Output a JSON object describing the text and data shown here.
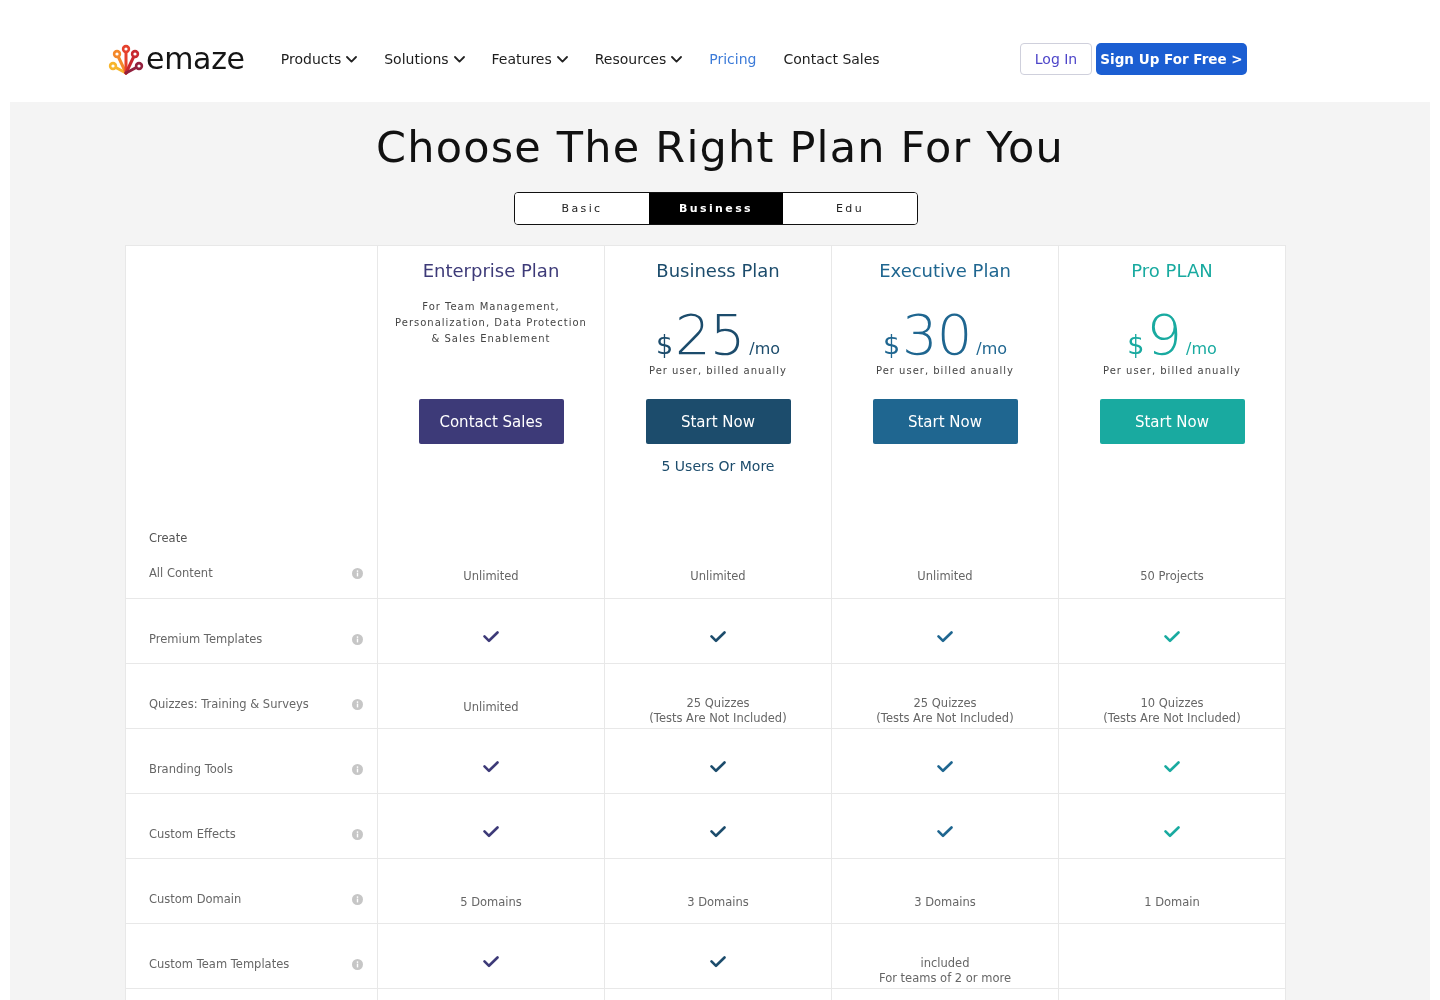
{
  "header": {
    "brand": "emaze",
    "nav": [
      {
        "label": "Products",
        "dropdown": true,
        "selected": false
      },
      {
        "label": "Solutions",
        "dropdown": true,
        "selected": false
      },
      {
        "label": "Features",
        "dropdown": true,
        "selected": false
      },
      {
        "label": "Resources",
        "dropdown": true,
        "selected": false
      },
      {
        "label": "Pricing",
        "dropdown": false,
        "selected": true
      },
      {
        "label": "Contact Sales",
        "dropdown": false,
        "selected": false
      }
    ],
    "login": "Log In",
    "signup": "Sign Up For Free >"
  },
  "title": "Choose The Right Plan For You",
  "tabs": [
    {
      "label": "Basic",
      "selected": false
    },
    {
      "label": "Business",
      "selected": true
    },
    {
      "label": "Edu",
      "selected": false
    }
  ],
  "plans": [
    {
      "name": "Enterprise Plan",
      "color": "#3d3a78",
      "description": "For Team Management,\nPersonalization, Data Protection\n& Sales Enablement",
      "button": "Contact Sales"
    },
    {
      "name": "Business Plan",
      "color": "#1c4c6c",
      "price": {
        "currency": "$",
        "amount": "25",
        "period": "/mo"
      },
      "billing": "Per user, billed anually",
      "button": "Start Now",
      "note": "5 Users Or More"
    },
    {
      "name": "Executive Plan",
      "color": "#1f6690",
      "price": {
        "currency": "$",
        "amount": "30",
        "period": "/mo"
      },
      "billing": "Per user, billed anually",
      "button": "Start Now"
    },
    {
      "name": "Pro PLAN",
      "color": "#19aaa0",
      "price": {
        "currency": "$",
        "amount": "9",
        "period": "/mo"
      },
      "billing": "Per user, billed anually",
      "button": "Start Now"
    }
  ],
  "features": {
    "group": "Create",
    "rows": [
      {
        "label": "All Content",
        "values": [
          {
            "kind": "text",
            "text": "Unlimited"
          },
          {
            "kind": "text",
            "text": "Unlimited"
          },
          {
            "kind": "text",
            "text": "Unlimited"
          },
          {
            "kind": "text",
            "text": "50 Projects"
          }
        ]
      },
      {
        "label": "Premium Templates",
        "values": [
          {
            "kind": "check"
          },
          {
            "kind": "check"
          },
          {
            "kind": "check"
          },
          {
            "kind": "check"
          }
        ]
      },
      {
        "label": "Quizzes: Training & Surveys",
        "values": [
          {
            "kind": "text",
            "text": "Unlimited"
          },
          {
            "kind": "text",
            "text": "25 Quizzes\n(Tests Are Not Included)"
          },
          {
            "kind": "text",
            "text": "25 Quizzes\n(Tests Are Not Included)"
          },
          {
            "kind": "text",
            "text": "10 Quizzes\n(Tests Are Not Included)"
          }
        ]
      },
      {
        "label": "Branding Tools",
        "values": [
          {
            "kind": "check"
          },
          {
            "kind": "check"
          },
          {
            "kind": "check"
          },
          {
            "kind": "check"
          }
        ]
      },
      {
        "label": "Custom Effects",
        "values": [
          {
            "kind": "check"
          },
          {
            "kind": "check"
          },
          {
            "kind": "check"
          },
          {
            "kind": "check"
          }
        ]
      },
      {
        "label": "Custom Domain",
        "values": [
          {
            "kind": "text",
            "text": "5 Domains"
          },
          {
            "kind": "text",
            "text": "3 Domains"
          },
          {
            "kind": "text",
            "text": "3 Domains"
          },
          {
            "kind": "text",
            "text": "1 Domain"
          }
        ]
      },
      {
        "label": "Custom Team Templates",
        "values": [
          {
            "kind": "check"
          },
          {
            "kind": "check"
          },
          {
            "kind": "text",
            "text": "included\nFor teams of 2 or more"
          },
          {
            "kind": "blank"
          }
        ]
      }
    ]
  }
}
